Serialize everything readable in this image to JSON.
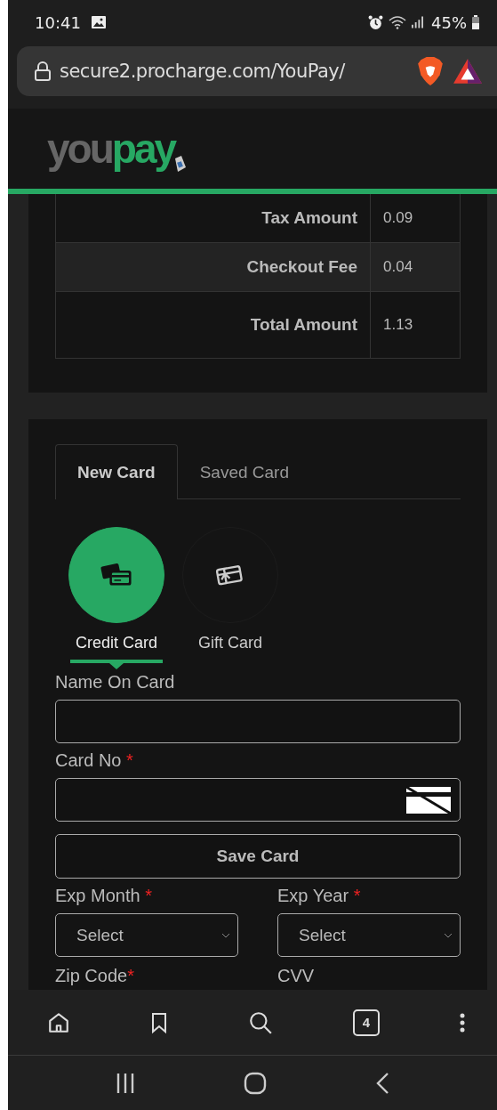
{
  "status_bar": {
    "time": "10:41",
    "battery": "45%"
  },
  "address_bar": {
    "url": "secure2.procharge.com/YouPay/"
  },
  "header": {
    "logo_left": "you",
    "logo_right": "pay"
  },
  "summary_rows": [
    {
      "label": "Tax Amount",
      "value": "0.09",
      "striped": false
    },
    {
      "label": "Checkout Fee",
      "value": "0.04",
      "striped": true
    },
    {
      "label": "Total Amount",
      "value": "1.13",
      "striped": false
    }
  ],
  "tabs": [
    {
      "label": "New Card",
      "selected": true
    },
    {
      "label": "Saved Card",
      "selected": false
    }
  ],
  "payment_methods": [
    {
      "label": "Credit Card",
      "kind": "credit",
      "selected": true
    },
    {
      "label": "Gift Card",
      "kind": "gift",
      "selected": false
    }
  ],
  "name_field": {
    "label": "Name On Card"
  },
  "card_field": {
    "label": "Card No",
    "required_mark": "*"
  },
  "save_button": "Save Card",
  "selects": [
    {
      "label": "Exp Month",
      "required_mark": "*",
      "value": "Select"
    },
    {
      "label": "Exp Year",
      "required_mark": "*",
      "value": "Select"
    }
  ],
  "cut_labels": [
    {
      "label": "Zip Code",
      "required_mark": "*"
    },
    {
      "label": "CVV"
    }
  ],
  "bottom_nav": {
    "tab_count": "4"
  }
}
